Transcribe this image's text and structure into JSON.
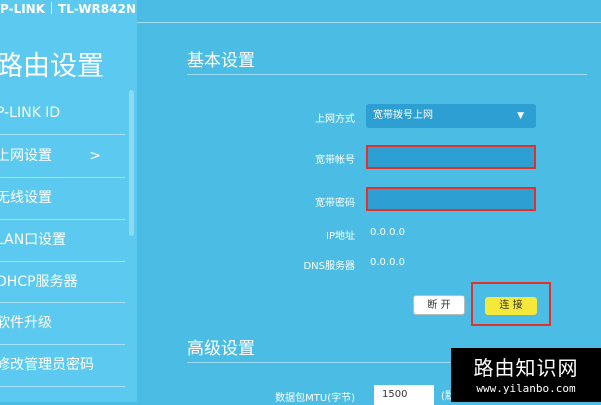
{
  "brand": {
    "logo": "P-LINK",
    "model": "TL-WR842N"
  },
  "sidebar": {
    "title": "路由设置",
    "items": [
      {
        "label": "P-LINK ID"
      },
      {
        "label": "上网设置",
        "chevron": ">"
      },
      {
        "label": "无线设置"
      },
      {
        "label": "LAN口设置"
      },
      {
        "label": "DHCP服务器"
      },
      {
        "label": "软件升级"
      },
      {
        "label": "修改管理员密码"
      }
    ]
  },
  "basic": {
    "title": "基本设置",
    "mode_label": "上网方式",
    "mode_value": "宽带拨号上网",
    "account_label": "宽带帐号",
    "account_value": "",
    "password_label": "宽带密码",
    "password_value": "",
    "ip_label": "IP地址",
    "ip_value": "0.0.0.0",
    "dns_label": "DNS服务器",
    "dns_value": "0.0.0.0",
    "disconnect_button": "断 开",
    "connect_button": "连 接"
  },
  "advanced": {
    "title": "高级设置",
    "mtu_label": "数据包MTU(字节)",
    "mtu_value": "1500",
    "mtu_extra": "(默"
  },
  "watermark": {
    "title": "路由知识网",
    "url": "www.yilanbo.com"
  },
  "colors": {
    "background": "#4bbde5",
    "sidebar": "#5ccaf0",
    "field": "#2d9fd3",
    "highlight": "#e3312a",
    "connect": "#f5e83a"
  }
}
